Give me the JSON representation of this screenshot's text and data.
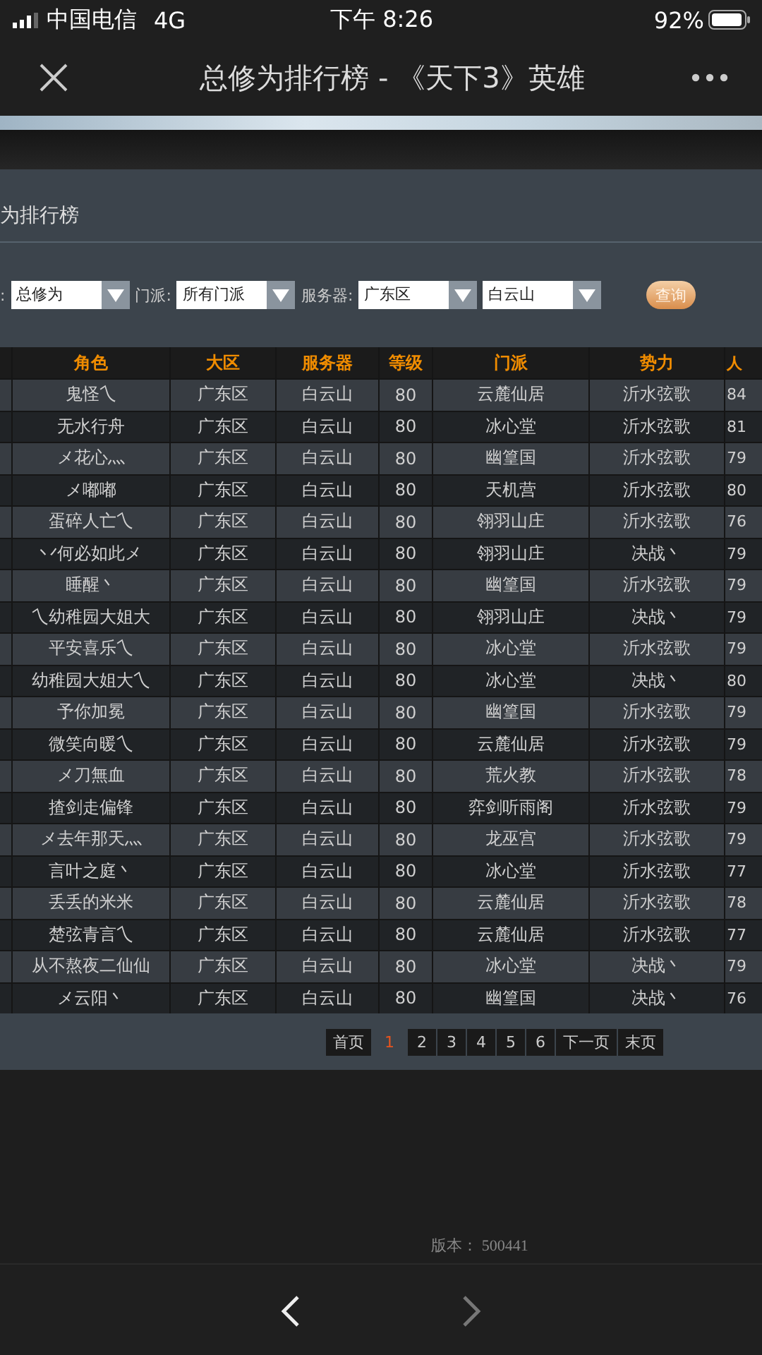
{
  "status_bar": {
    "carrier": "中国电信",
    "network": "4G",
    "time": "下午 8:26",
    "battery": "92%"
  },
  "nav": {
    "title": "总修为排行榜 - 《天下3》英雄"
  },
  "page": {
    "heading": "为排行榜",
    "filters": [
      {
        "label": ":",
        "value": "总修为"
      },
      {
        "label": "门派:",
        "value": "所有门派"
      },
      {
        "label": "服务器:",
        "value": "广东区"
      },
      {
        "value": "白云山"
      }
    ],
    "search_button": "查询",
    "table": {
      "columns": [
        "角色",
        "大区",
        "服务器",
        "等级",
        "门派",
        "势力",
        "人"
      ],
      "rows": [
        [
          "鬼怪乀",
          "广东区",
          "白云山",
          "80",
          "云麓仙居",
          "沂水弦歌",
          "84"
        ],
        [
          "无水行舟",
          "广东区",
          "白云山",
          "80",
          "冰心堂",
          "沂水弦歌",
          "81"
        ],
        [
          "メ花心灬",
          "广东区",
          "白云山",
          "80",
          "幽篁国",
          "沂水弦歌",
          "79"
        ],
        [
          "メ嘟嘟",
          "广东区",
          "白云山",
          "80",
          "天机营",
          "沂水弦歌",
          "80"
        ],
        [
          "蛋碎人亡乀",
          "广东区",
          "白云山",
          "80",
          "翎羽山庄",
          "沂水弦歌",
          "76"
        ],
        [
          "丷何必如此メ",
          "广东区",
          "白云山",
          "80",
          "翎羽山庄",
          "决战丶",
          "79"
        ],
        [
          "睡醒丶",
          "广东区",
          "白云山",
          "80",
          "幽篁国",
          "沂水弦歌",
          "79"
        ],
        [
          "乀幼稚园大姐大",
          "广东区",
          "白云山",
          "80",
          "翎羽山庄",
          "决战丶",
          "79"
        ],
        [
          "平安喜乐乀",
          "广东区",
          "白云山",
          "80",
          "冰心堂",
          "沂水弦歌",
          "79"
        ],
        [
          "幼稚园大姐大乀",
          "广东区",
          "白云山",
          "80",
          "冰心堂",
          "决战丶",
          "80"
        ],
        [
          "予你加冕",
          "广东区",
          "白云山",
          "80",
          "幽篁国",
          "沂水弦歌",
          "79"
        ],
        [
          "微笑向暖乀",
          "广东区",
          "白云山",
          "80",
          "云麓仙居",
          "沂水弦歌",
          "79"
        ],
        [
          "メ刀無血",
          "广东区",
          "白云山",
          "80",
          "荒火教",
          "沂水弦歌",
          "78"
        ],
        [
          "揸剑走偏锋",
          "广东区",
          "白云山",
          "80",
          "弈剑听雨阁",
          "沂水弦歌",
          "79"
        ],
        [
          "メ去年那天灬",
          "广东区",
          "白云山",
          "80",
          "龙巫宫",
          "沂水弦歌",
          "79"
        ],
        [
          "言叶之庭丶",
          "广东区",
          "白云山",
          "80",
          "冰心堂",
          "沂水弦歌",
          "77"
        ],
        [
          "丢丢的米米",
          "广东区",
          "白云山",
          "80",
          "云麓仙居",
          "沂水弦歌",
          "78"
        ],
        [
          "楚弦青言乀",
          "广东区",
          "白云山",
          "80",
          "云麓仙居",
          "沂水弦歌",
          "77"
        ],
        [
          "从不熬夜二仙仙",
          "广东区",
          "白云山",
          "80",
          "冰心堂",
          "决战丶",
          "79"
        ],
        [
          "メ云阳丶",
          "广东区",
          "白云山",
          "80",
          "幽篁国",
          "决战丶",
          "76"
        ]
      ]
    },
    "pagination": [
      {
        "label": "首页",
        "selected": false
      },
      {
        "label": "1",
        "selected": true
      },
      {
        "label": "2",
        "selected": false
      },
      {
        "label": "3",
        "selected": false
      },
      {
        "label": "4",
        "selected": false
      },
      {
        "label": "5",
        "selected": false
      },
      {
        "label": "6",
        "selected": false
      },
      {
        "label": "下一页",
        "selected": false
      },
      {
        "label": "末页",
        "selected": false
      }
    ],
    "version": "版本： 500441"
  },
  "toolbar": {
    "back": {
      "disabled": false
    },
    "forward": {
      "disabled": true
    }
  }
}
